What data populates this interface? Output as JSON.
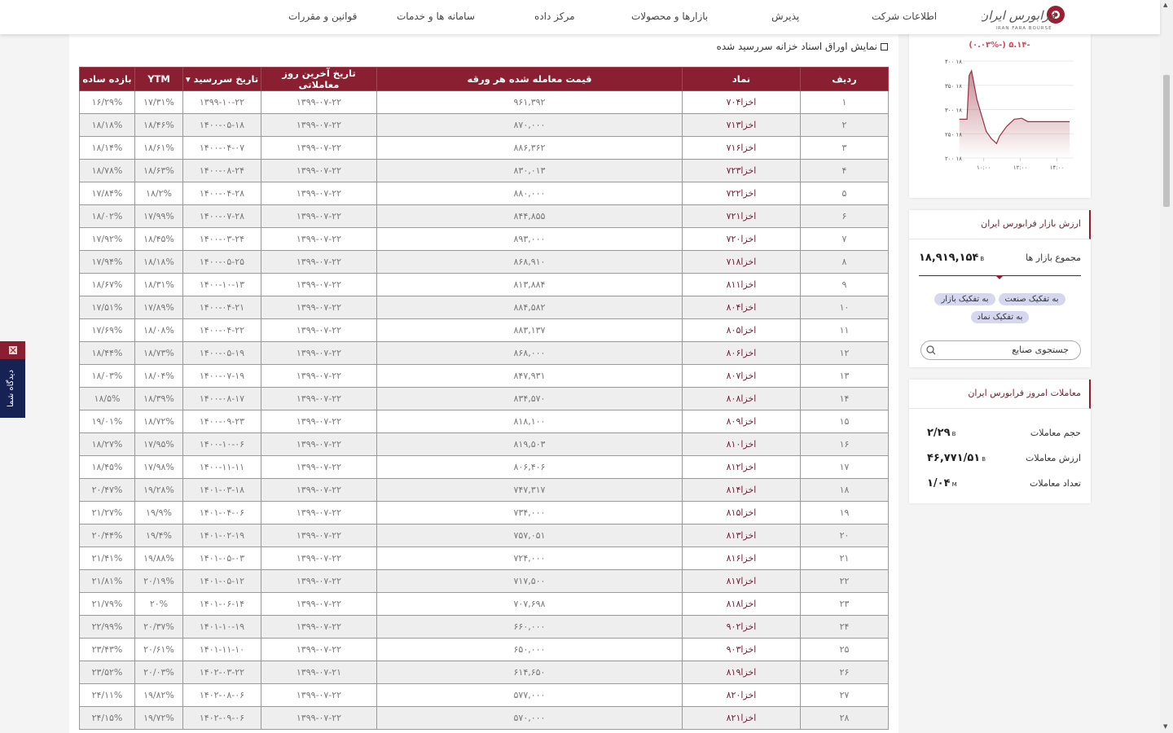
{
  "header": {
    "logo_text": "فرابورس ایران",
    "logo_sub": "IRAN FARA BOURSE",
    "nav": [
      "اطلاعات شرکت",
      "پذیرش",
      "بازارها و محصولات",
      "مرکز داده",
      "سامانه ها و خدمات",
      "قوانین و مقررات"
    ]
  },
  "filter": {
    "label": "نمایش اوراق اسناد خزانه سررسید شده",
    "checked": false
  },
  "table": {
    "columns": [
      "ردیف",
      "نماد",
      "قیمت معامله شده هر ورقه",
      "تاریخ آخرین روز معاملاتی",
      "تاریخ سررسید ▾",
      "YTM",
      "بازده ساده"
    ],
    "rows": [
      [
        "۱",
        "اخزا۷۰۴",
        "۹۶۱,۳۹۲",
        "۱۳۹۹-۰۷-۲۲",
        "۱۳۹۹-۱۰-۲۲",
        "۱۷/۳۱%",
        "۱۶/۲۹%"
      ],
      [
        "۲",
        "اخزا۷۱۳",
        "۸۷۰,۰۰۰",
        "۱۳۹۹-۰۷-۲۲",
        "۱۴۰۰-۰۵-۱۸",
        "۱۸/۴۶%",
        "۱۸/۱۸%"
      ],
      [
        "۳",
        "اخزا۷۱۶",
        "۸۸۶,۳۶۲",
        "۱۳۹۹-۰۷-۲۲",
        "۱۴۰۰-۰۴-۰۷",
        "۱۸/۶۱%",
        "۱۸/۱۴%"
      ],
      [
        "۴",
        "اخزا۷۲۳",
        "۸۳۰,۰۱۳",
        "۱۳۹۹-۰۷-۲۲",
        "۱۴۰۰-۰۸-۲۴",
        "۱۸/۶۳%",
        "۱۸/۷۸%"
      ],
      [
        "۵",
        "اخزا۷۲۲",
        "۸۸۰,۰۰۰",
        "۱۳۹۹-۰۷-۲۲",
        "۱۴۰۰-۰۴-۲۸",
        "۱۸/۲%",
        "۱۷/۸۴%"
      ],
      [
        "۶",
        "اخزا۷۲۱",
        "۸۴۴,۸۵۵",
        "۱۳۹۹-۰۷-۲۲",
        "۱۴۰۰-۰۷-۲۸",
        "۱۷/۹۹%",
        "۱۸/۰۲%"
      ],
      [
        "۷",
        "اخزا۷۲۰",
        "۸۹۳,۰۰۰",
        "۱۳۹۹-۰۷-۲۲",
        "۱۴۰۰-۰۳-۲۴",
        "۱۸/۴۵%",
        "۱۷/۹۲%"
      ],
      [
        "۸",
        "اخزا۷۱۸",
        "۸۶۸,۹۱۰",
        "۱۳۹۹-۰۷-۲۲",
        "۱۴۰۰-۰۵-۲۵",
        "۱۸/۱۸%",
        "۱۷/۹۴%"
      ],
      [
        "۹",
        "اخزا۸۱۱",
        "۸۱۳,۸۸۴",
        "۱۳۹۹-۰۷-۲۲",
        "۱۴۰۰-۱۰-۱۳",
        "۱۸/۳۱%",
        "۱۸/۶۷%"
      ],
      [
        "۱۰",
        "اخزا۸۰۴",
        "۸۸۴,۵۸۲",
        "۱۳۹۹-۰۷-۲۲",
        "۱۴۰۰-۰۴-۲۱",
        "۱۷/۸۹%",
        "۱۷/۵۱%"
      ],
      [
        "۱۱",
        "اخزا۸۰۵",
        "۸۸۳,۱۳۷",
        "۱۳۹۹-۰۷-۲۲",
        "۱۴۰۰-۰۴-۲۲",
        "۱۸/۰۸%",
        "۱۷/۶۹%"
      ],
      [
        "۱۲",
        "اخزا۸۰۶",
        "۸۶۸,۰۰۰",
        "۱۳۹۹-۰۷-۲۲",
        "۱۴۰۰-۰۵-۱۹",
        "۱۸/۷۳%",
        "۱۸/۴۴%"
      ],
      [
        "۱۳",
        "اخزا۸۰۷",
        "۸۴۷,۹۳۱",
        "۱۳۹۹-۰۷-۲۲",
        "۱۴۰۰-۰۷-۱۹",
        "۱۸/۰۴%",
        "۱۸/۰۳%"
      ],
      [
        "۱۴",
        "اخزا۸۰۸",
        "۸۳۴,۵۷۰",
        "۱۳۹۹-۰۷-۲۲",
        "۱۴۰۰-۰۸-۱۷",
        "۱۸/۳۹%",
        "۱۸/۵%"
      ],
      [
        "۱۵",
        "اخزا۸۰۹",
        "۸۱۸,۱۰۰",
        "۱۳۹۹-۰۷-۲۲",
        "۱۴۰۰-۰۹-۲۳",
        "۱۸/۷۲%",
        "۱۹/۰۱%"
      ],
      [
        "۱۶",
        "اخزا۸۱۰",
        "۸۱۹,۵۰۳",
        "۱۳۹۹-۰۷-۲۲",
        "۱۴۰۰-۱۰-۰۶",
        "۱۷/۹۵%",
        "۱۸/۲۷%"
      ],
      [
        "۱۷",
        "اخزا۸۱۲",
        "۸۰۶,۴۰۶",
        "۱۳۹۹-۰۷-۲۲",
        "۱۴۰۰-۱۱-۱۱",
        "۱۷/۹۸%",
        "۱۸/۴۵%"
      ],
      [
        "۱۸",
        "اخزا۸۱۴",
        "۷۴۷,۳۱۷",
        "۱۳۹۹-۰۷-۲۲",
        "۱۴۰۱-۰۳-۱۸",
        "۱۹/۲۸%",
        "۲۰/۴۷%"
      ],
      [
        "۱۹",
        "اخزا۸۱۵",
        "۷۳۴,۰۰۰",
        "۱۳۹۹-۰۷-۲۲",
        "۱۴۰۱-۰۴-۰۶",
        "۱۹/۹%",
        "۲۱/۲۷%"
      ],
      [
        "۲۰",
        "اخزا۸۱۳",
        "۷۵۷,۰۵۱",
        "۱۳۹۹-۰۷-۲۲",
        "۱۴۰۱-۰۲-۱۹",
        "۱۹/۴%",
        "۲۰/۴۴%"
      ],
      [
        "۲۱",
        "اخزا۸۱۶",
        "۷۲۴,۰۰۰",
        "۱۳۹۹-۰۷-۲۲",
        "۱۴۰۱-۰۵-۰۳",
        "۱۹/۸۸%",
        "۲۱/۴۱%"
      ],
      [
        "۲۲",
        "اخزا۸۱۷",
        "۷۱۷,۵۰۰",
        "۱۳۹۹-۰۷-۲۲",
        "۱۴۰۱-۰۵-۱۲",
        "۲۰/۱۹%",
        "۲۱/۸۱%"
      ],
      [
        "۲۳",
        "اخزا۸۱۸",
        "۷۰۷,۶۹۸",
        "۱۳۹۹-۰۷-۲۲",
        "۱۴۰۱-۰۶-۱۴",
        "۲۰%",
        "۲۱/۷۹%"
      ],
      [
        "۲۴",
        "اخزا۹۰۲",
        "۶۶۰,۰۰۰",
        "۱۳۹۹-۰۷-۲۲",
        "۱۴۰۱-۱۰-۱۹",
        "۲۰/۳۷%",
        "۲۲/۹۹%"
      ],
      [
        "۲۵",
        "اخزا۹۰۳",
        "۶۵۰,۰۰۰",
        "۱۳۹۹-۰۷-۲۲",
        "۱۴۰۱-۱۱-۱۰",
        "۲۰/۶۱%",
        "۲۳/۴۳%"
      ],
      [
        "۲۶",
        "اخزا۸۱۹",
        "۶۱۴,۶۵۰",
        "۱۳۹۹-۰۷-۲۱",
        "۱۴۰۲-۰۳-۲۲",
        "۲۰/۰۳%",
        "۲۳/۵۲%"
      ],
      [
        "۲۷",
        "اخزا۸۲۰",
        "۵۷۷,۰۰۰",
        "۱۳۹۹-۰۷-۲۲",
        "۱۴۰۲-۰۸-۰۶",
        "۱۹/۸۲%",
        "۲۴/۱۱%"
      ],
      [
        "۲۸",
        "اخزا۸۲۱",
        "۵۷۰,۰۰۰",
        "۱۳۹۹-۰۷-۲۲",
        "۱۴۰۲-۰۹-۰۶",
        "۱۹/۷۲%",
        "۲۴/۱۵%"
      ]
    ]
  },
  "chart_data": {
    "type": "area",
    "change_label": "-۵.۱۴ (-۰.۰۳%)",
    "y_ticks": [
      "۱۸ ۴۰۰",
      "۱۸ ۳۵۰",
      "۱۸ ۳۰۰",
      "۱۸ ۲۵۰",
      "۱۸ ۲۰۰"
    ],
    "x_ticks": [
      "۱۰:۰۰",
      "۱۲:۰۰",
      "۱۴:۰۰"
    ],
    "ylim": [
      18200,
      18400
    ],
    "xlim": [
      "08:30",
      "14:55"
    ],
    "grid": true,
    "color": "#9a3040",
    "x": [
      "08:40",
      "09:05",
      "09:12",
      "09:20",
      "09:38",
      "10:08",
      "10:25",
      "10:42",
      "10:52",
      "11:15",
      "11:40",
      "12:05",
      "12:25",
      "14:42"
    ],
    "y": [
      18280,
      18280,
      18370,
      18380,
      18320,
      18255,
      18240,
      18230,
      18245,
      18265,
      18280,
      18282,
      18275,
      18275
    ]
  },
  "market_value": {
    "title": "ارزش بازار فرابورس ایران",
    "total_label": "مجموع بازار ها",
    "total_value": "۱۸,۹۱۹,۱۵۴",
    "total_unit": "B",
    "pills": [
      "به تفکیک صنعت",
      "به تفکیک بازار",
      "به تفکیک نماد"
    ],
    "search_placeholder": "جستجوی صنایع"
  },
  "today": {
    "title": "معاملات امروز فرابورس ایران",
    "rows": [
      {
        "label": "حجم معاملات",
        "value": "۲/۲۹",
        "unit": "B"
      },
      {
        "label": "ارزش معاملات",
        "value": "۴۶,۷۷۱/۵۱",
        "unit": "B"
      },
      {
        "label": "تعداد معاملات",
        "value": "۱/۰۴",
        "unit": "M"
      }
    ]
  },
  "side_tab": {
    "label": "دیدگاه شما"
  },
  "colors": {
    "brand": "#8a1f31",
    "navy": "#172254",
    "pill": "#d5d7ef"
  }
}
